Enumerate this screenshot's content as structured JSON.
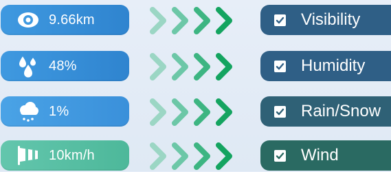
{
  "metrics": [
    {
      "icon": "eye-icon",
      "value": "9.66km",
      "label": "Visibility",
      "color_from": "#3f99e0",
      "color_to": "#2f84cf",
      "tag_color": "#2f5f86"
    },
    {
      "icon": "water-drops-icon",
      "value": "48%",
      "label": "Humidity",
      "color_from": "#3f99e0",
      "color_to": "#2f84cf",
      "tag_color": "#2f5f86"
    },
    {
      "icon": "rain-cloud-icon",
      "value": "1%",
      "label": "Rain/Snow",
      "color_from": "#4aa3e6",
      "color_to": "#3a90da",
      "tag_color": "#2f6176"
    },
    {
      "icon": "windsock-icon",
      "value": "10km/h",
      "label": "Wind",
      "color_from": "#63c6ad",
      "color_to": "#4db89a",
      "tag_color": "#2a6a62"
    }
  ],
  "chevron_colors": [
    "#9bd6c4",
    "#6cc7a7",
    "#3db582",
    "#14a460"
  ]
}
